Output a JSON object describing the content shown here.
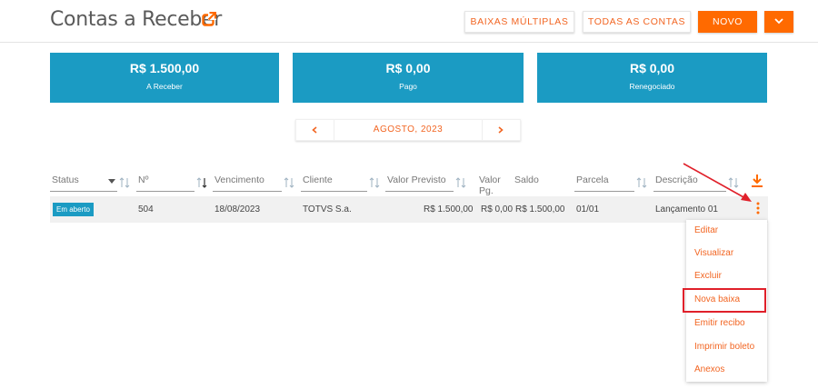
{
  "header": {
    "title": "Contas a Receber",
    "buttons": {
      "baixas_multiplas": "BAIXAS MÚLTIPLAS",
      "todas_as_contas": "TODAS AS CONTAS",
      "novo": "NOVO"
    }
  },
  "summary": [
    {
      "value": "R$ 1.500,00",
      "label": "A Receber"
    },
    {
      "value": "R$ 0,00",
      "label": "Pago"
    },
    {
      "value": "R$ 0,00",
      "label": "Renegociado"
    }
  ],
  "month_nav": {
    "label": "AGOSTO, 2023"
  },
  "table": {
    "columns": [
      "Status",
      "Nº",
      "Vencimento",
      "Cliente",
      "Valor Previsto",
      "Valor Pg.",
      "Saldo",
      "Parcela",
      "Descrição"
    ],
    "rows": [
      {
        "status": "Em aberto",
        "numero": "504",
        "vencimento": "18/08/2023",
        "cliente": "TOTVS S.a.",
        "valor_previsto": "R$ 1.500,00",
        "valor_pg": "R$ 0,00",
        "saldo": "R$ 1.500,00",
        "parcela": "01/01",
        "descricao": "Lançamento 01"
      }
    ]
  },
  "context_menu": {
    "items": [
      "Editar",
      "Visualizar",
      "Excluir",
      "Nova baixa",
      "Emitir recibo",
      "Imprimir boleto",
      "Anexos"
    ],
    "highlighted_item": "Nova baixa"
  },
  "colors": {
    "accent": "#ff6a00",
    "accent_text": "#f26522",
    "card_blue": "#1b9bc3",
    "annotation_red": "#e0202a"
  },
  "icons": [
    "external-link-icon",
    "chevron-down-icon",
    "chevron-left-icon",
    "chevron-right-icon",
    "sort-icon",
    "download-icon",
    "kebab-menu-icon"
  ]
}
